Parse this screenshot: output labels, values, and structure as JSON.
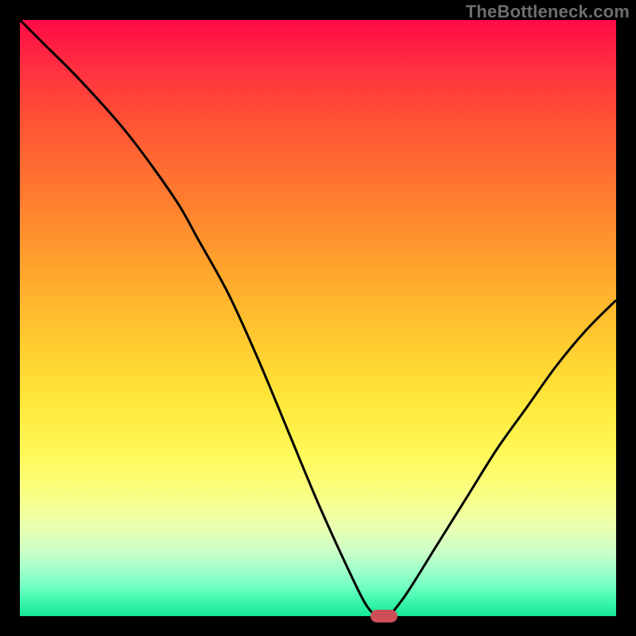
{
  "watermark": "TheBottleneck.com",
  "chart_data": {
    "type": "line",
    "title": "",
    "xlabel": "",
    "ylabel": "",
    "xlim": [
      0,
      100
    ],
    "ylim": [
      0,
      100
    ],
    "grid": false,
    "legend": false,
    "annotations": [],
    "background_gradient": "vertical red-to-green spectrum indicating bottleneck severity (top = high, bottom = low)",
    "series": [
      {
        "name": "left-branch",
        "x": [
          0,
          4,
          10,
          18,
          26,
          30,
          35,
          40,
          45,
          50,
          55,
          58,
          60,
          62
        ],
        "y": [
          100,
          96,
          90,
          81,
          70,
          63,
          54,
          43,
          31,
          19,
          8,
          2,
          0,
          0
        ]
      },
      {
        "name": "right-branch",
        "x": [
          62,
          65,
          70,
          75,
          80,
          85,
          90,
          95,
          100
        ],
        "y": [
          0,
          4,
          12,
          20,
          28,
          35,
          42,
          48,
          53
        ]
      }
    ],
    "minimum_marker": {
      "x": 61,
      "y": 0
    }
  },
  "colors": {
    "curve": "#000000",
    "marker": "#cf4d58",
    "frame": "#000000"
  }
}
